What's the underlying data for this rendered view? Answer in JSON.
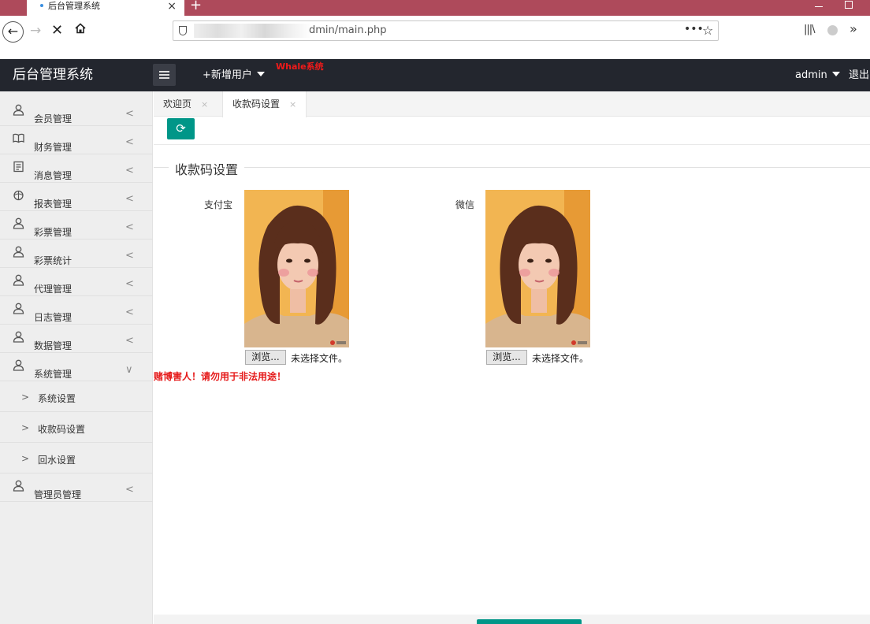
{
  "browser": {
    "tab_title": "后台管理系统",
    "tab_close": "×",
    "new_tab": "+",
    "url_suffix": "dmin/main.php",
    "url_menu": "•••",
    "url_bookmark": "☆",
    "back": "←",
    "forward": "→",
    "stop": "✕",
    "library": "|||\\",
    "overflow": "»"
  },
  "header": {
    "title": "后台管理系统",
    "add_user": "+新增用户",
    "watermark": "Whale系统",
    "user": "admin",
    "logout": "退出"
  },
  "sidebar": {
    "items": [
      {
        "label": "会员管理",
        "icon": "user-icon",
        "arrow": "<"
      },
      {
        "label": "财务管理",
        "icon": "book-icon",
        "arrow": "<"
      },
      {
        "label": "消息管理",
        "icon": "document-icon",
        "arrow": "<"
      },
      {
        "label": "报表管理",
        "icon": "globe-icon",
        "arrow": "<"
      },
      {
        "label": "彩票管理",
        "icon": "user-icon",
        "arrow": "<"
      },
      {
        "label": "彩票统计",
        "icon": "user-icon",
        "arrow": "<"
      },
      {
        "label": "代理管理",
        "icon": "user-icon",
        "arrow": "<"
      },
      {
        "label": "日志管理",
        "icon": "user-icon",
        "arrow": "<"
      },
      {
        "label": "数据管理",
        "icon": "user-icon",
        "arrow": "<"
      },
      {
        "label": "系统管理",
        "icon": "user-icon",
        "arrow": "∨"
      }
    ],
    "subitems": [
      {
        "label": "系统设置",
        "arrow": ">"
      },
      {
        "label": "收款码设置",
        "arrow": ">"
      },
      {
        "label": "回水设置",
        "arrow": ">"
      }
    ],
    "last_item": {
      "label": "管理员管理",
      "icon": "user-icon",
      "arrow": "<"
    }
  },
  "tabs": [
    {
      "label": "欢迎页",
      "close": "×"
    },
    {
      "label": "收款码设置",
      "close": "×"
    }
  ],
  "content": {
    "refresh_icon": "⟳",
    "section_title": "收款码设置",
    "alipay_label": "支付宝",
    "wechat_label": "微信",
    "browse_label": "浏览...",
    "no_file": "未选择文件。",
    "warning": "赌博害人！请勿用于非法用途！"
  },
  "colors": {
    "browser_tab_strip": "#ae4a5b",
    "header_bg": "#23262e",
    "accent": "#009688",
    "warning": "#e51a1a"
  }
}
